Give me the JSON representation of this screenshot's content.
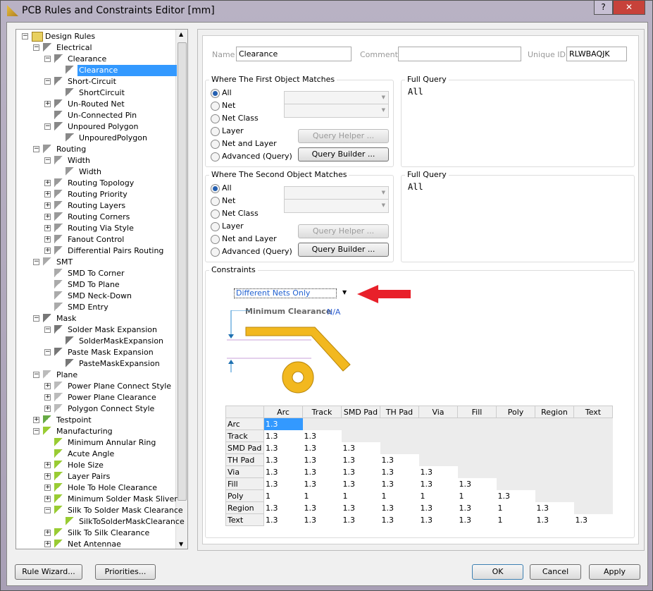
{
  "window": {
    "title": "PCB Rules and Constraints Editor [mm]",
    "help": "?",
    "close": "✕"
  },
  "tree": [
    {
      "l": 0,
      "e": "-",
      "t": "Design Rules",
      "i": "folder"
    },
    {
      "l": 1,
      "e": "-",
      "t": "Electrical",
      "i": "elec"
    },
    {
      "l": 2,
      "e": "-",
      "t": "Clearance",
      "i": "elec"
    },
    {
      "l": 3,
      "e": "",
      "t": "Clearance",
      "i": "elec",
      "sel": true
    },
    {
      "l": 2,
      "e": "-",
      "t": "Short-Circuit",
      "i": "elec"
    },
    {
      "l": 3,
      "e": "",
      "t": "ShortCircuit",
      "i": "elec"
    },
    {
      "l": 2,
      "e": "+",
      "t": "Un-Routed Net",
      "i": "elec"
    },
    {
      "l": 2,
      "e": "",
      "t": "Un-Connected Pin",
      "i": "elec"
    },
    {
      "l": 2,
      "e": "-",
      "t": "Unpoured Polygon",
      "i": "elec"
    },
    {
      "l": 3,
      "e": "",
      "t": "UnpouredPolygon",
      "i": "elec"
    },
    {
      "l": 1,
      "e": "-",
      "t": "Routing",
      "i": "route"
    },
    {
      "l": 2,
      "e": "-",
      "t": "Width",
      "i": "route"
    },
    {
      "l": 3,
      "e": "",
      "t": "Width",
      "i": "route"
    },
    {
      "l": 2,
      "e": "+",
      "t": "Routing Topology",
      "i": "route"
    },
    {
      "l": 2,
      "e": "+",
      "t": "Routing Priority",
      "i": "route"
    },
    {
      "l": 2,
      "e": "+",
      "t": "Routing Layers",
      "i": "route"
    },
    {
      "l": 2,
      "e": "+",
      "t": "Routing Corners",
      "i": "route"
    },
    {
      "l": 2,
      "e": "+",
      "t": "Routing Via Style",
      "i": "route"
    },
    {
      "l": 2,
      "e": "+",
      "t": "Fanout Control",
      "i": "route"
    },
    {
      "l": 2,
      "e": "+",
      "t": "Differential Pairs Routing",
      "i": "route"
    },
    {
      "l": 1,
      "e": "-",
      "t": "SMT",
      "i": "smt"
    },
    {
      "l": 2,
      "e": "",
      "t": "SMD To Corner",
      "i": "smt"
    },
    {
      "l": 2,
      "e": "",
      "t": "SMD To Plane",
      "i": "smt"
    },
    {
      "l": 2,
      "e": "",
      "t": "SMD Neck-Down",
      "i": "smt"
    },
    {
      "l": 2,
      "e": "",
      "t": "SMD Entry",
      "i": "smt"
    },
    {
      "l": 1,
      "e": "-",
      "t": "Mask",
      "i": "mask"
    },
    {
      "l": 2,
      "e": "-",
      "t": "Solder Mask Expansion",
      "i": "mask"
    },
    {
      "l": 3,
      "e": "",
      "t": "SolderMaskExpansion",
      "i": "mask"
    },
    {
      "l": 2,
      "e": "-",
      "t": "Paste Mask Expansion",
      "i": "mask"
    },
    {
      "l": 3,
      "e": "",
      "t": "PasteMaskExpansion",
      "i": "mask"
    },
    {
      "l": 1,
      "e": "-",
      "t": "Plane",
      "i": "plane"
    },
    {
      "l": 2,
      "e": "+",
      "t": "Power Plane Connect Style",
      "i": "plane"
    },
    {
      "l": 2,
      "e": "+",
      "t": "Power Plane Clearance",
      "i": "plane"
    },
    {
      "l": 2,
      "e": "+",
      "t": "Polygon Connect Style",
      "i": "plane"
    },
    {
      "l": 1,
      "e": "+",
      "t": "Testpoint",
      "i": "test"
    },
    {
      "l": 1,
      "e": "-",
      "t": "Manufacturing",
      "i": "mfg"
    },
    {
      "l": 2,
      "e": "",
      "t": "Minimum Annular Ring",
      "i": "mfg"
    },
    {
      "l": 2,
      "e": "",
      "t": "Acute Angle",
      "i": "mfg"
    },
    {
      "l": 2,
      "e": "+",
      "t": "Hole Size",
      "i": "mfg"
    },
    {
      "l": 2,
      "e": "+",
      "t": "Layer Pairs",
      "i": "mfg"
    },
    {
      "l": 2,
      "e": "+",
      "t": "Hole To Hole Clearance",
      "i": "mfg"
    },
    {
      "l": 2,
      "e": "+",
      "t": "Minimum Solder Mask Sliver",
      "i": "mfg"
    },
    {
      "l": 2,
      "e": "-",
      "t": "Silk To Solder Mask Clearance",
      "i": "mfg"
    },
    {
      "l": 3,
      "e": "",
      "t": "SilkToSolderMaskClearance",
      "i": "mfg"
    },
    {
      "l": 2,
      "e": "+",
      "t": "Silk To Silk Clearance",
      "i": "mfg"
    },
    {
      "l": 2,
      "e": "+",
      "t": "Net Antennae",
      "i": "mfg"
    }
  ],
  "rule": {
    "name_label": "Name",
    "name": "Clearance",
    "comment_label": "Comment",
    "comment": "",
    "uid_label": "Unique ID",
    "uid": "RLWBAQJK"
  },
  "first": {
    "title": "Where The First Object Matches",
    "query_title": "Full Query",
    "query": "All",
    "options": [
      "All",
      "Net",
      "Net Class",
      "Layer",
      "Net and Layer",
      "Advanced (Query)"
    ],
    "selected": 0,
    "helper": "Query Helper ...",
    "builder": "Query Builder ..."
  },
  "second": {
    "title": "Where The Second Object Matches",
    "query_title": "Full Query",
    "query": "All",
    "options": [
      "All",
      "Net",
      "Net Class",
      "Layer",
      "Net and Layer",
      "Advanced (Query)"
    ],
    "selected": 0,
    "helper": "Query Helper ...",
    "builder": "Query Builder ..."
  },
  "constraints": {
    "title": "Constraints",
    "mode": "Different Nets Only",
    "min_label": "Minimum Clearance",
    "min_value": "N/A",
    "columns": [
      "Arc",
      "Track",
      "SMD Pad",
      "TH Pad",
      "Via",
      "Fill",
      "Poly",
      "Region",
      "Text"
    ],
    "rows": [
      {
        "h": "Arc",
        "v": [
          "1.3"
        ]
      },
      {
        "h": "Track",
        "v": [
          "1.3",
          "1.3"
        ]
      },
      {
        "h": "SMD Pad",
        "v": [
          "1.3",
          "1.3",
          "1.3"
        ]
      },
      {
        "h": "TH Pad",
        "v": [
          "1.3",
          "1.3",
          "1.3",
          "1.3"
        ]
      },
      {
        "h": "Via",
        "v": [
          "1.3",
          "1.3",
          "1.3",
          "1.3",
          "1.3"
        ]
      },
      {
        "h": "Fill",
        "v": [
          "1.3",
          "1.3",
          "1.3",
          "1.3",
          "1.3",
          "1.3"
        ]
      },
      {
        "h": "Poly",
        "v": [
          "1",
          "1",
          "1",
          "1",
          "1",
          "1",
          "1.3"
        ]
      },
      {
        "h": "Region",
        "v": [
          "1.3",
          "1.3",
          "1.3",
          "1.3",
          "1.3",
          "1.3",
          "1",
          "1.3"
        ]
      },
      {
        "h": "Text",
        "v": [
          "1.3",
          "1.3",
          "1.3",
          "1.3",
          "1.3",
          "1.3",
          "1",
          "1.3",
          "1.3"
        ]
      }
    ]
  },
  "footer": {
    "wizard": "Rule Wizard...",
    "priorities": "Priorities...",
    "ok": "OK",
    "cancel": "Cancel",
    "apply": "Apply"
  },
  "colors": {
    "selection": "#3399ff",
    "accent_arrow": "#e8202a",
    "copper": "#f2b81f"
  }
}
